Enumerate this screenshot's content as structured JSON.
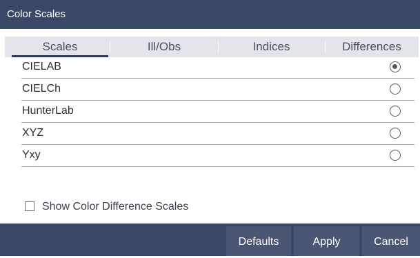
{
  "window": {
    "title": "Color Scales"
  },
  "tabs": [
    {
      "label": "Scales",
      "active": true
    },
    {
      "label": "Ill/Obs",
      "active": false
    },
    {
      "label": "Indices",
      "active": false
    },
    {
      "label": "Differences",
      "active": false
    }
  ],
  "scales": [
    {
      "label": "CIELAB",
      "selected": true
    },
    {
      "label": "CIELCh",
      "selected": false
    },
    {
      "label": "HunterLab",
      "selected": false
    },
    {
      "label": "XYZ",
      "selected": false
    },
    {
      "label": "Yxy",
      "selected": false
    }
  ],
  "options": {
    "show_difference_label": "Show Color Difference Scales",
    "show_difference_checked": false
  },
  "buttons": {
    "defaults": "Defaults",
    "apply": "Apply",
    "cancel": "Cancel"
  },
  "colors": {
    "header": "#3b4767",
    "button": "#4a5674",
    "tab_bar": "#e4e5ea",
    "divider": "#a7a9ae"
  }
}
